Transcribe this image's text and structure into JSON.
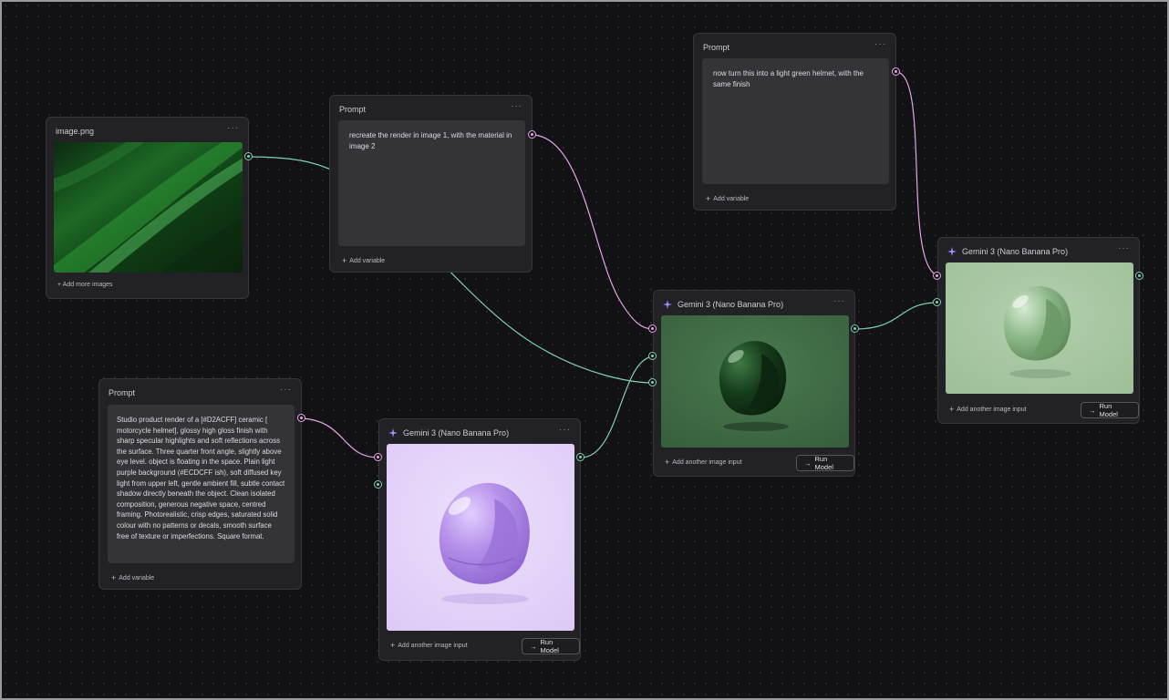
{
  "canvas": {
    "background": "#121114",
    "wire_green": "#7fd1b0",
    "wire_pink": "#e3a5e8",
    "model_accent": "#a58bff"
  },
  "image_node": {
    "title": "image.png",
    "menu": "···",
    "add_images": "+ Add more images"
  },
  "prompt_top": {
    "title": "Prompt",
    "menu": "···",
    "text": "recreate the render in image 1, with the material in image 2",
    "add_variable": "Add variable"
  },
  "prompt_right": {
    "title": "Prompt",
    "menu": "···",
    "text": "now turn this into a light green helmet, with the same finish",
    "add_variable": "Add variable"
  },
  "prompt_left": {
    "title": "Prompt",
    "menu": "···",
    "text": "Studio product render of a [#D2ACFF] ceramic [ motorcycle helmet], glossy high gloss finish with sharp specular highlights and soft reflections across the surface. Three quarter front angle, slightly above eye level. object is floating in the space. Plain light purple  background (#ECDCFF ish), soft diffused key light from upper left, gentle ambient fill, subtle contact shadow directly beneath the object. Clean isolated composition, generous negative space, centred framing. Photorealistic, crisp edges, saturated solid colour with no patterns or decals, smooth surface free of texture or imperfections. Square format.",
    "add_variable": "Add variable"
  },
  "model_purple": {
    "title": "Gemini 3 (Nano Banana Pro)",
    "menu": "···",
    "add_input": "Add another image input",
    "run": "Run Model",
    "helmet_color": "#b89ae0",
    "bg_color": "#e7d8fb"
  },
  "model_dark": {
    "title": "Gemini 3 (Nano Banana Pro)",
    "menu": "···",
    "add_input": "Add another image input",
    "run": "Run Model",
    "helmet_color": "#1f4a25",
    "bg_color": "#3e6b43"
  },
  "model_light": {
    "title": "Gemini 3 (Nano Banana Pro)",
    "menu": "···",
    "add_input": "Add another image input",
    "run": "Run Model",
    "helmet_color": "#8fb98a",
    "bg_color": "#a5c6a0"
  }
}
